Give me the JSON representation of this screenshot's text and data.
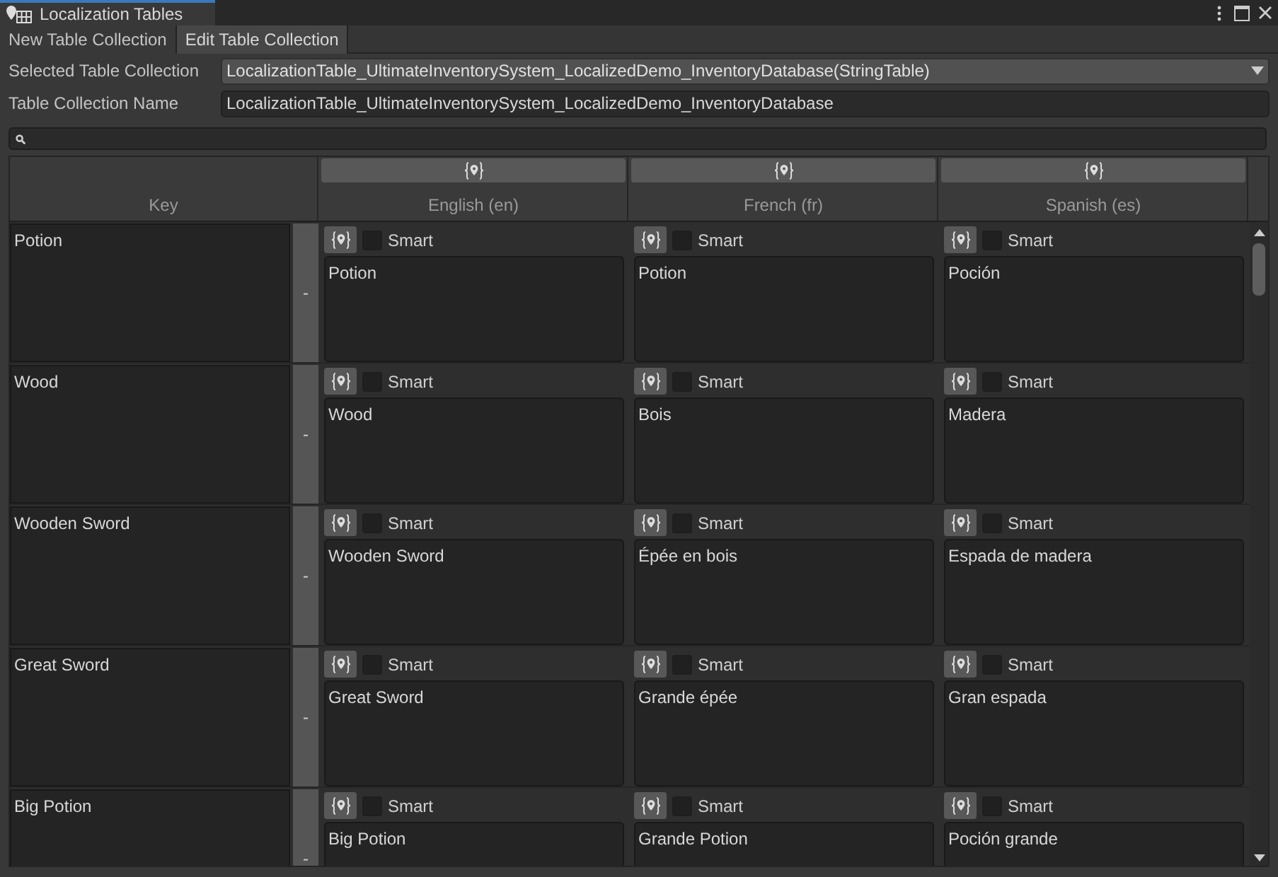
{
  "window": {
    "title": "Localization Tables"
  },
  "toolbar": [
    {
      "label": "New Table Collection",
      "selected": false
    },
    {
      "label": "Edit Table Collection",
      "selected": true
    }
  ],
  "selected_table_collection": {
    "label": "Selected Table Collection",
    "value": "LocalizationTable_UltimateInventorySystem_LocalizedDemo_InventoryDatabase(StringTable)"
  },
  "table_collection_name": {
    "label": "Table Collection Name",
    "value": "LocalizationTable_UltimateInventorySystem_LocalizedDemo_InventoryDatabase"
  },
  "table": {
    "key_header": "Key",
    "languages": [
      "English (en)",
      "French (fr)",
      "Spanish (es)"
    ],
    "rows": [
      {
        "key": "Potion",
        "remove": "-",
        "entries": [
          {
            "smart": false,
            "smart_label": "Smart",
            "text": "Potion"
          },
          {
            "smart": false,
            "smart_label": "Smart",
            "text": "Potion"
          },
          {
            "smart": false,
            "smart_label": "Smart",
            "text": "Poción"
          }
        ]
      },
      {
        "key": "Wood",
        "remove": "-",
        "entries": [
          {
            "smart": false,
            "smart_label": "Smart",
            "text": "Wood"
          },
          {
            "smart": false,
            "smart_label": "Smart",
            "text": "Bois"
          },
          {
            "smart": false,
            "smart_label": "Smart",
            "text": "Madera"
          }
        ]
      },
      {
        "key": "Wooden Sword",
        "remove": "-",
        "entries": [
          {
            "smart": false,
            "smart_label": "Smart",
            "text": "Wooden Sword"
          },
          {
            "smart": false,
            "smart_label": "Smart",
            "text": "Épée en bois"
          },
          {
            "smart": false,
            "smart_label": "Smart",
            "text": "Espada de madera"
          }
        ]
      },
      {
        "key": "Great Sword",
        "remove": "-",
        "entries": [
          {
            "smart": false,
            "smart_label": "Smart",
            "text": "Great Sword"
          },
          {
            "smart": false,
            "smart_label": "Smart",
            "text": "Grande épée"
          },
          {
            "smart": false,
            "smart_label": "Smart",
            "text": "Gran espada"
          }
        ]
      },
      {
        "key": "Big Potion",
        "remove": "-",
        "entries": [
          {
            "smart": false,
            "smart_label": "Smart",
            "text": "Big Potion"
          },
          {
            "smart": false,
            "smart_label": "Smart",
            "text": "Grande Potion"
          },
          {
            "smart": false,
            "smart_label": "Smart",
            "text": "Poción grande"
          }
        ]
      }
    ]
  }
}
